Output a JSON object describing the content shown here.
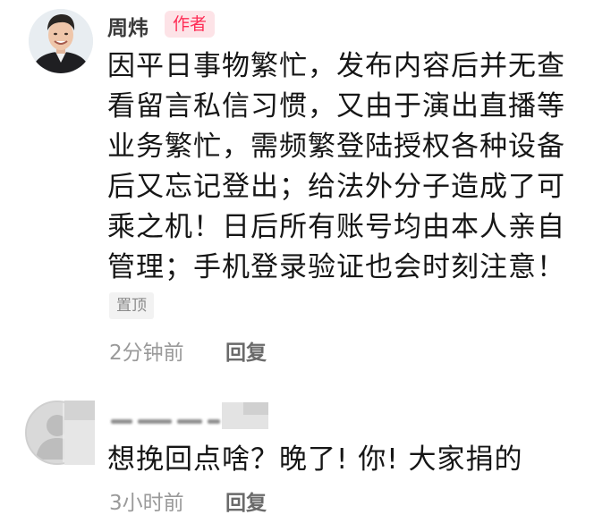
{
  "comments": [
    {
      "username": "周炜",
      "badge": "作者",
      "lines": [
        "因平日事物繁忙，发布内容后并无查",
        "看留言私信习惯，又由于演出直播等",
        "业务繁忙，需频繁登陆授权各种设备",
        "后又忘记登出；给法外分子造成了可",
        "乘之机！日后所有账号均由本人亲自",
        "管理；手机登录验证也会时刻注意！"
      ],
      "pin_label": "置顶",
      "time": "2分钟前",
      "reply_label": "回复"
    },
    {
      "username": "",
      "lines": [
        "想挽回点啥？晚了! 你! 大家捐的"
      ],
      "time": "3小时前",
      "reply_label": "回复"
    }
  ],
  "colors": {
    "badge_text": "#fe2c55",
    "badge_bg": "#fde3e7",
    "meta_text": "#9a9a9a",
    "reply_text": "#6a6a6a"
  }
}
